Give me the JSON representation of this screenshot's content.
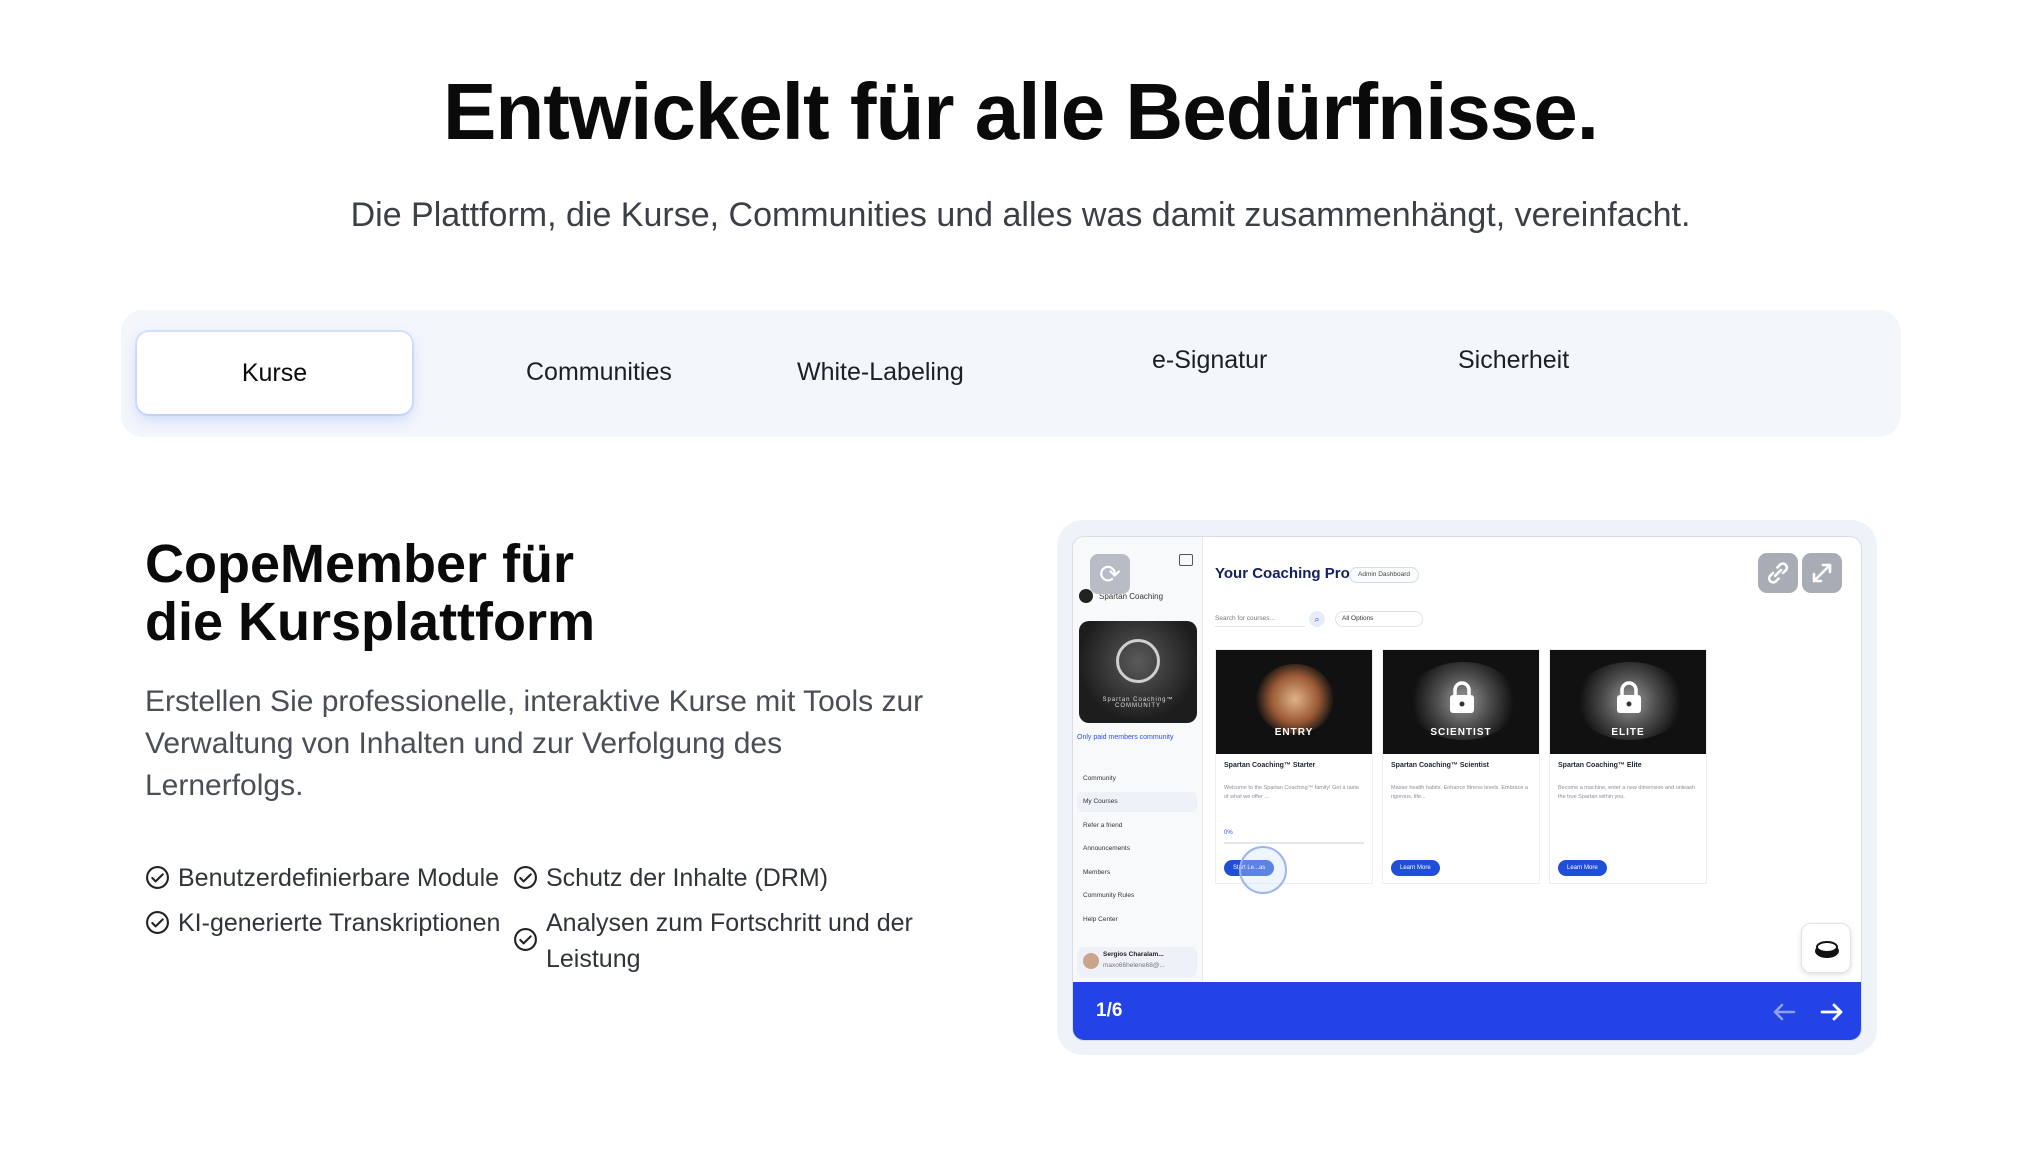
{
  "hero": {
    "title": "Entwickelt für alle Bedürfnisse.",
    "subtitle": "Die Plattform, die Kurse, Communities und alles was damit zusammenhängt, vereinfacht."
  },
  "tabs": [
    {
      "label": "Kurse",
      "active": true
    },
    {
      "label": "Communities",
      "active": false
    },
    {
      "label": "White-Labeling",
      "active": false
    },
    {
      "label": "e-Signatur",
      "active": false
    },
    {
      "label": "Sicherheit",
      "active": false
    }
  ],
  "feature": {
    "title_line1": "CopeMember für",
    "title_line2": "die Kursplattform",
    "description": "Erstellen Sie professionelle, interaktive Kurse mit Tools zur Verwaltung von Inhalten und zur Verfolgung des Lernerfolgs.",
    "bullets": [
      "Benutzerdefinierbare Module",
      "Schutz der Inhalte (DRM)",
      "KI-generierte Transkriptionen",
      "Analysen zum Fortschritt und der Leistung"
    ]
  },
  "demo": {
    "counter": "1/6",
    "accent_color": "#2443e6",
    "sidebar": {
      "brand": "Spartan Coaching",
      "logo_caption": "Spartan Coaching™ COMMUNITY",
      "note": "Only paid members community",
      "items": [
        "Community",
        "My Courses",
        "Refer a friend",
        "Announcements",
        "Members",
        "Community Rules",
        "Help Center"
      ],
      "user_name": "Sergios Charalam...",
      "user_email": "maxo66helene68@..."
    },
    "main": {
      "title": "Your Coaching Programs",
      "admin_label": "Admin Dashboard",
      "search_placeholder": "Search for courses...",
      "filter_label": "All Options"
    },
    "cards": [
      {
        "label": "ENTRY",
        "title": "Spartan Coaching™ Starter",
        "desc": "Welcome to the Spartan Coaching™ family! Get a taste of what we offer ...",
        "progress": "0%",
        "button": "Start Le...as",
        "locked": false
      },
      {
        "label": "SCIENTIST",
        "title": "Spartan Coaching™ Scientist",
        "desc": "Master health habits. Enhance fitness levels. Embrace a rigorous, life...",
        "button": "Learn More",
        "locked": true
      },
      {
        "label": "ELITE",
        "title": "Spartan Coaching™ Elite",
        "desc": "Become a machine, enter a new dimension and unleash the true Spartan within you.",
        "button": "Learn More",
        "locked": true
      }
    ],
    "icons": [
      "refresh-icon",
      "link-icon",
      "expand-icon",
      "arrow-left-icon",
      "arrow-right-icon",
      "chat-badge-icon"
    ]
  }
}
